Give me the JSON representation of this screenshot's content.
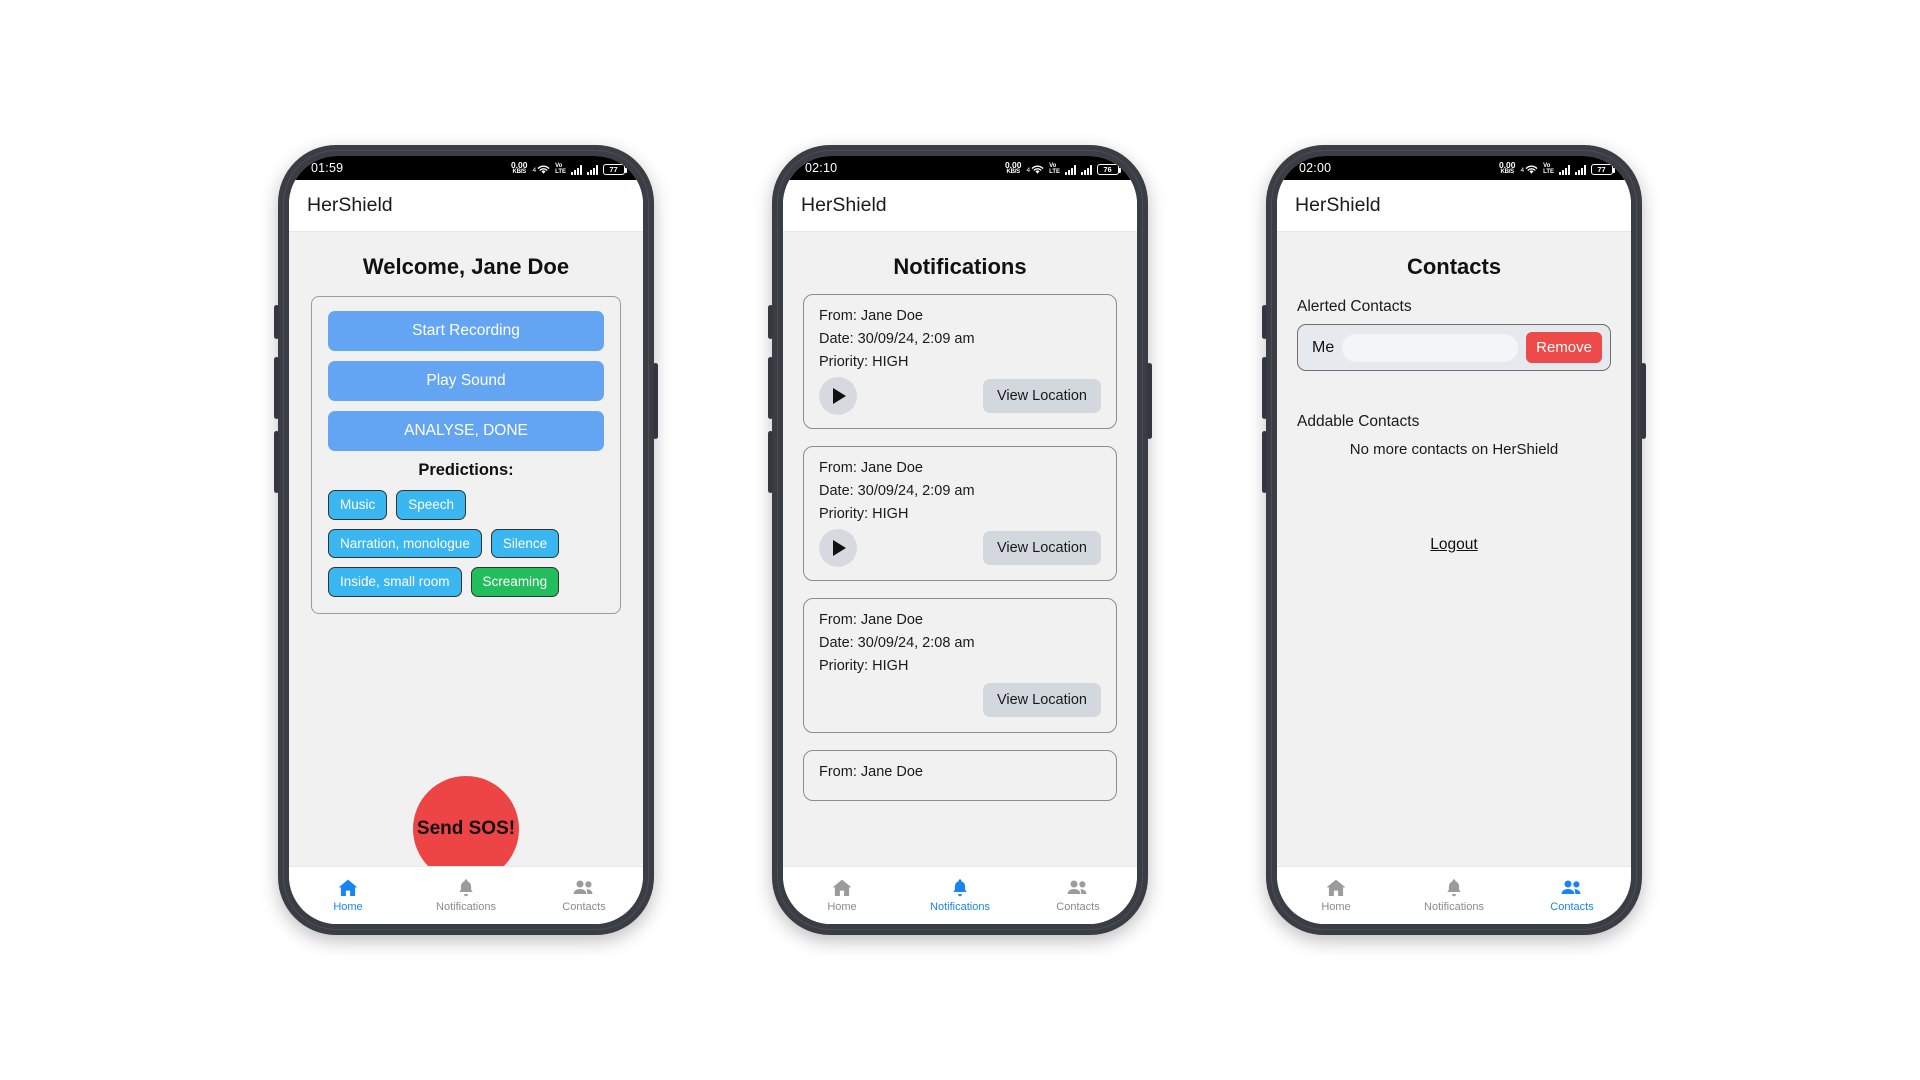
{
  "app": {
    "name": "HerShield"
  },
  "nav": {
    "items": [
      {
        "label": "Home",
        "icon": "home-icon"
      },
      {
        "label": "Notifications",
        "icon": "bell-icon"
      },
      {
        "label": "Contacts",
        "icon": "people-icon"
      }
    ]
  },
  "colors": {
    "accent_blue": "#1a84f2",
    "button_blue": "#63a4f3",
    "tag_blue": "#3ab6f0",
    "tag_green": "#22bd5c",
    "danger_red": "#ed4545",
    "remove_red": "#ee4a4a",
    "screen_bg": "#f1f1f1"
  },
  "phones": [
    {
      "status": {
        "time": "01:59",
        "net_rate": "0.00",
        "net_unit": "KB/S",
        "wifi": "4",
        "volte_top": "Vo",
        "volte_bottom": "LTE",
        "battery": "77"
      },
      "appbar_title": "HerShield",
      "screen": "home",
      "active_nav": 0,
      "home": {
        "greeting": "Welcome, Jane Doe",
        "buttons": [
          {
            "label": "Start Recording"
          },
          {
            "label": "Play Sound"
          },
          {
            "label": "ANALYSE, DONE"
          }
        ],
        "predictions_label": "Predictions:",
        "predictions": [
          {
            "label": "Music",
            "color": "blue"
          },
          {
            "label": "Speech",
            "color": "blue"
          },
          {
            "label": "Narration, monologue",
            "color": "blue"
          },
          {
            "label": "Silence",
            "color": "blue"
          },
          {
            "label": "Inside, small room",
            "color": "blue"
          },
          {
            "label": "Screaming",
            "color": "green"
          }
        ],
        "sos_label": "Send SOS!"
      }
    },
    {
      "status": {
        "time": "02:10",
        "net_rate": "0.00",
        "net_unit": "KB/S",
        "wifi": "4",
        "volte_top": "Vo",
        "volte_bottom": "LTE",
        "battery": "76"
      },
      "appbar_title": "HerShield",
      "screen": "notifications",
      "active_nav": 1,
      "notifications": {
        "title": "Notifications",
        "view_location_label": "View Location",
        "items": [
          {
            "from": "From: Jane Doe",
            "date": "Date: 30/09/24, 2:09 am",
            "priority": "Priority: HIGH",
            "has_play": true
          },
          {
            "from": "From: Jane Doe",
            "date": "Date: 30/09/24, 2:09 am",
            "priority": "Priority: HIGH",
            "has_play": true
          },
          {
            "from": "From: Jane Doe",
            "date": "Date: 30/09/24, 2:08 am",
            "priority": "Priority: HIGH",
            "has_play": false
          },
          {
            "from": "From: Jane Doe",
            "date": "",
            "priority": "",
            "has_play": false
          }
        ]
      }
    },
    {
      "status": {
        "time": "02:00",
        "net_rate": "0.00",
        "net_unit": "KB/S",
        "wifi": "4",
        "volte_top": "Vo",
        "volte_bottom": "LTE",
        "battery": "77"
      },
      "appbar_title": "HerShield",
      "screen": "contacts",
      "active_nav": 2,
      "contacts": {
        "title": "Contacts",
        "alerted_label": "Alerted Contacts",
        "alerted": [
          {
            "name": "Me",
            "remove_label": "Remove"
          }
        ],
        "addable_label": "Addable Contacts",
        "addable_empty": "No more contacts on HerShield",
        "logout_label": "Logout"
      }
    }
  ]
}
